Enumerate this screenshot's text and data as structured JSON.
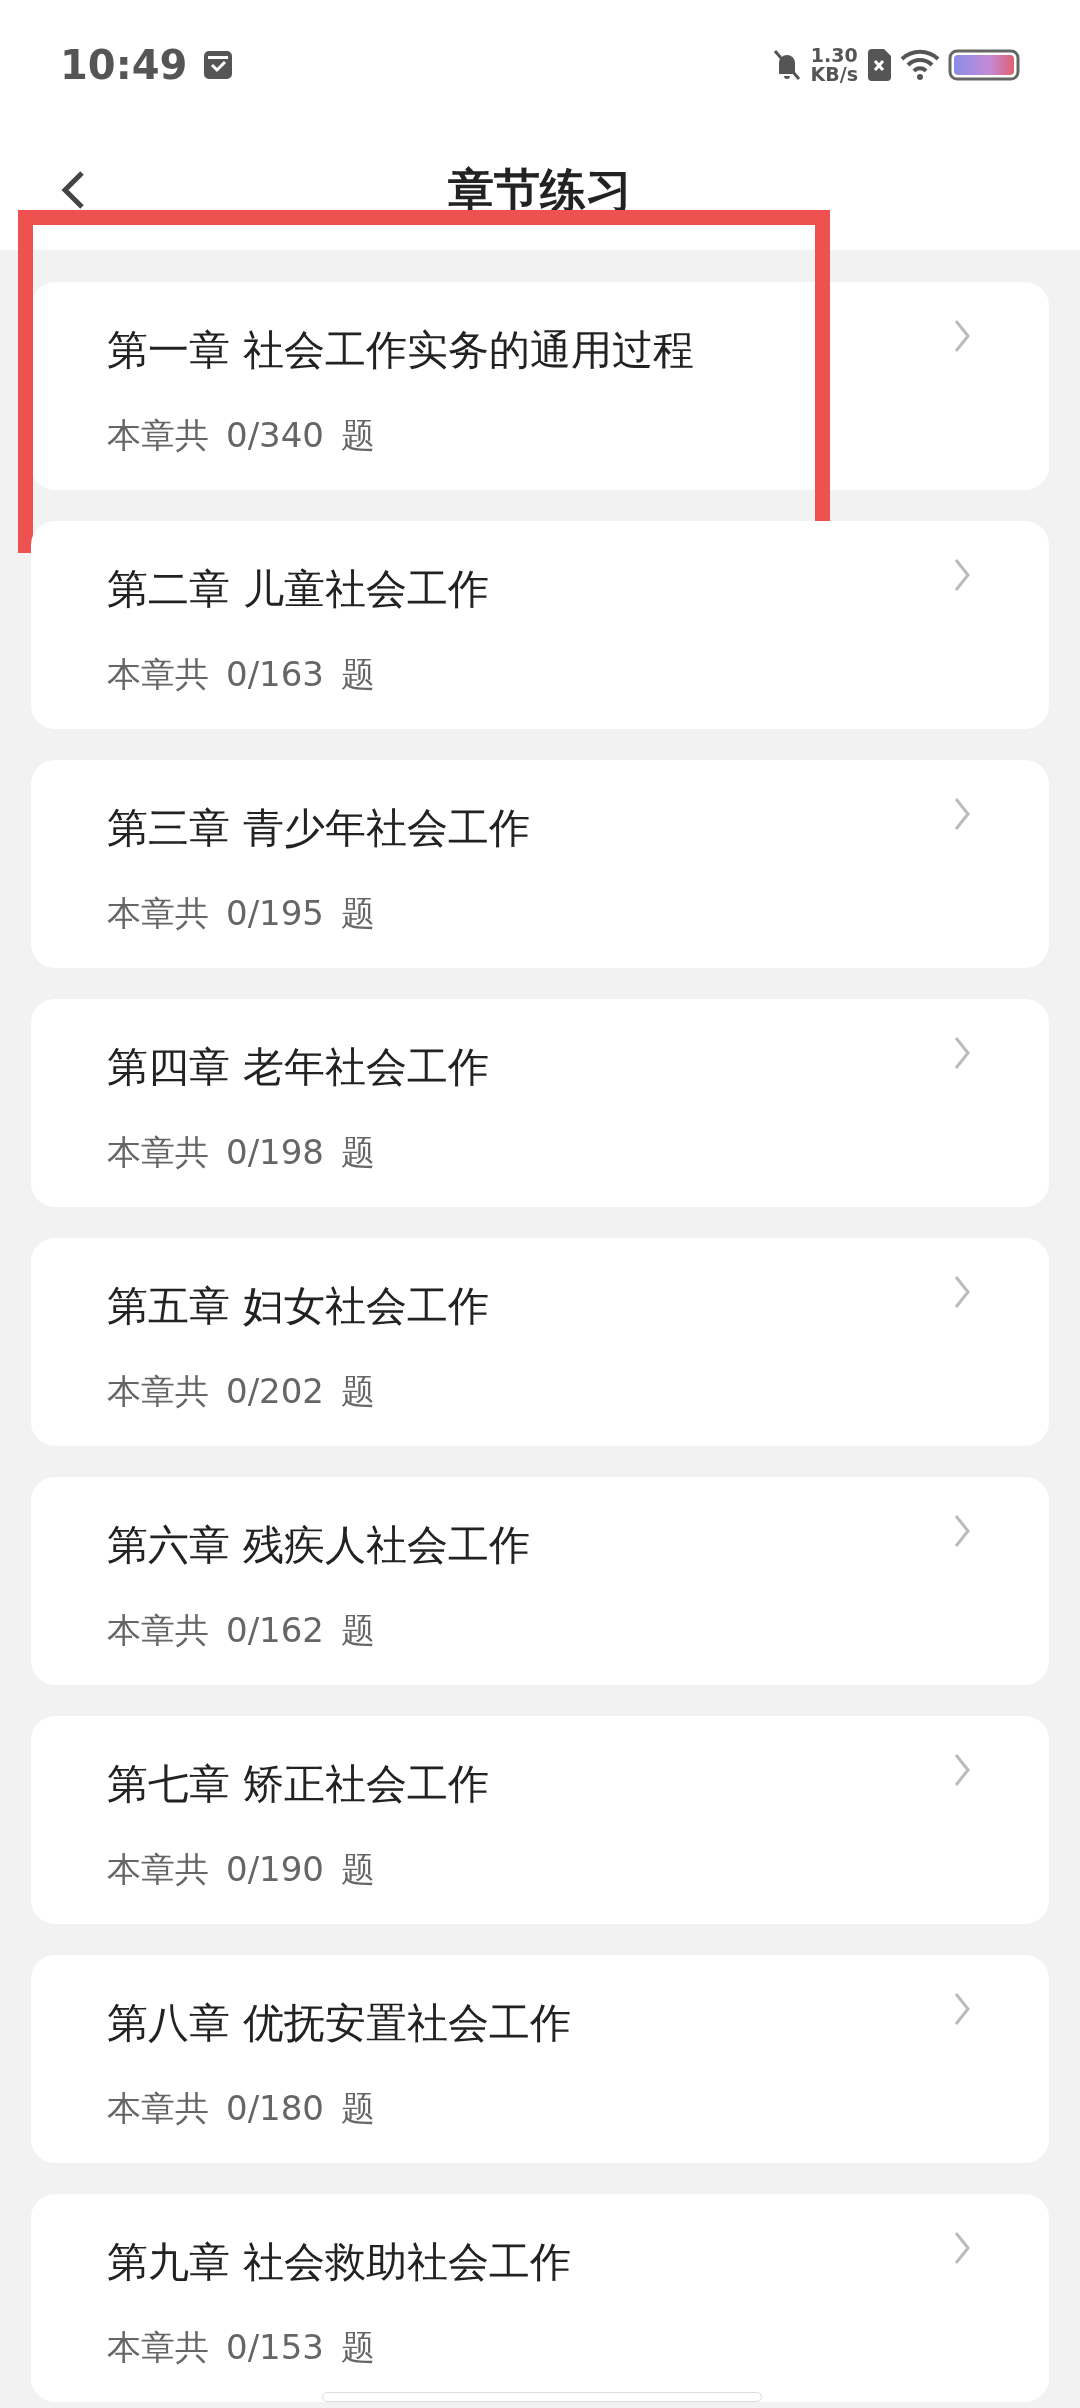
{
  "status_bar": {
    "time": "10:49",
    "net_speed": "1.30",
    "net_unit": "KB/s"
  },
  "header": {
    "title": "章节练习"
  },
  "chapters": [
    {
      "title": "第一章 社会工作实务的通用过程",
      "prefix": "本章共",
      "count": "0/340",
      "suffix": "题",
      "highlighted": true
    },
    {
      "title": "第二章 儿童社会工作",
      "prefix": "本章共",
      "count": "0/163",
      "suffix": "题",
      "highlighted": false
    },
    {
      "title": "第三章 青少年社会工作",
      "prefix": "本章共",
      "count": "0/195",
      "suffix": "题",
      "highlighted": false
    },
    {
      "title": "第四章 老年社会工作",
      "prefix": "本章共",
      "count": "0/198",
      "suffix": "题",
      "highlighted": false
    },
    {
      "title": "第五章 妇女社会工作",
      "prefix": "本章共",
      "count": "0/202",
      "suffix": "题",
      "highlighted": false
    },
    {
      "title": "第六章 残疾人社会工作",
      "prefix": "本章共",
      "count": "0/162",
      "suffix": "题",
      "highlighted": false
    },
    {
      "title": "第七章 矫正社会工作",
      "prefix": "本章共",
      "count": "0/190",
      "suffix": "题",
      "highlighted": false
    },
    {
      "title": "第八章 优抚安置社会工作",
      "prefix": "本章共",
      "count": "0/180",
      "suffix": "题",
      "highlighted": false
    },
    {
      "title": "第九章 社会救助社会工作",
      "prefix": "本章共",
      "count": "0/153",
      "suffix": "题",
      "highlighted": false
    }
  ]
}
